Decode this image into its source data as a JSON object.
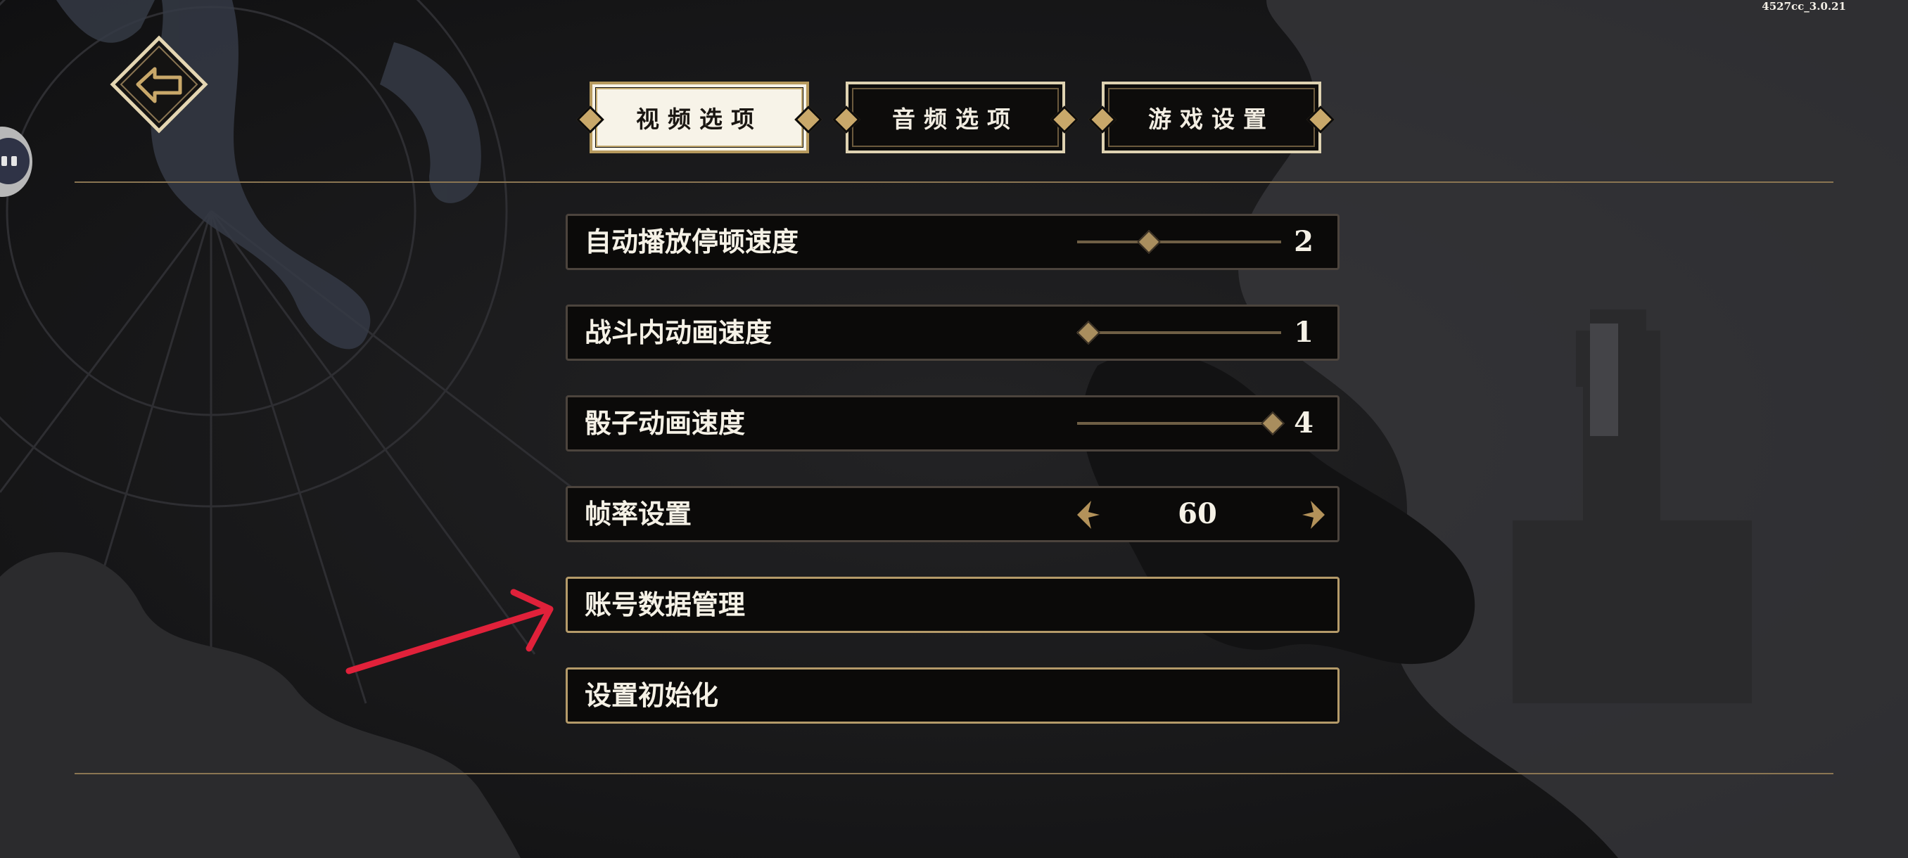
{
  "version": "4527cc_3.0.21",
  "back_button": {
    "icon": "back-arrow-icon"
  },
  "tabs": [
    {
      "label": "视频选项",
      "active": true
    },
    {
      "label": "音频选项",
      "active": false
    },
    {
      "label": "游戏设置",
      "active": false
    }
  ],
  "settings": {
    "autoplay_pause_speed": {
      "label": "自动播放停顿速度",
      "value": "2",
      "level": 0.33
    },
    "battle_animation_speed": {
      "label": "战斗内动画速度",
      "value": "1",
      "level": 0.0
    },
    "dice_animation_speed": {
      "label": "骰子动画速度",
      "value": "4",
      "level": 1.0
    },
    "frame_rate": {
      "label": "帧率设置",
      "value": "60"
    },
    "account_data_management": {
      "label": "账号数据管理"
    },
    "reset_settings": {
      "label": "设置初始化"
    }
  },
  "colors": {
    "accent_gold": "#c9a86a",
    "annotation_red": "#e0213a"
  }
}
